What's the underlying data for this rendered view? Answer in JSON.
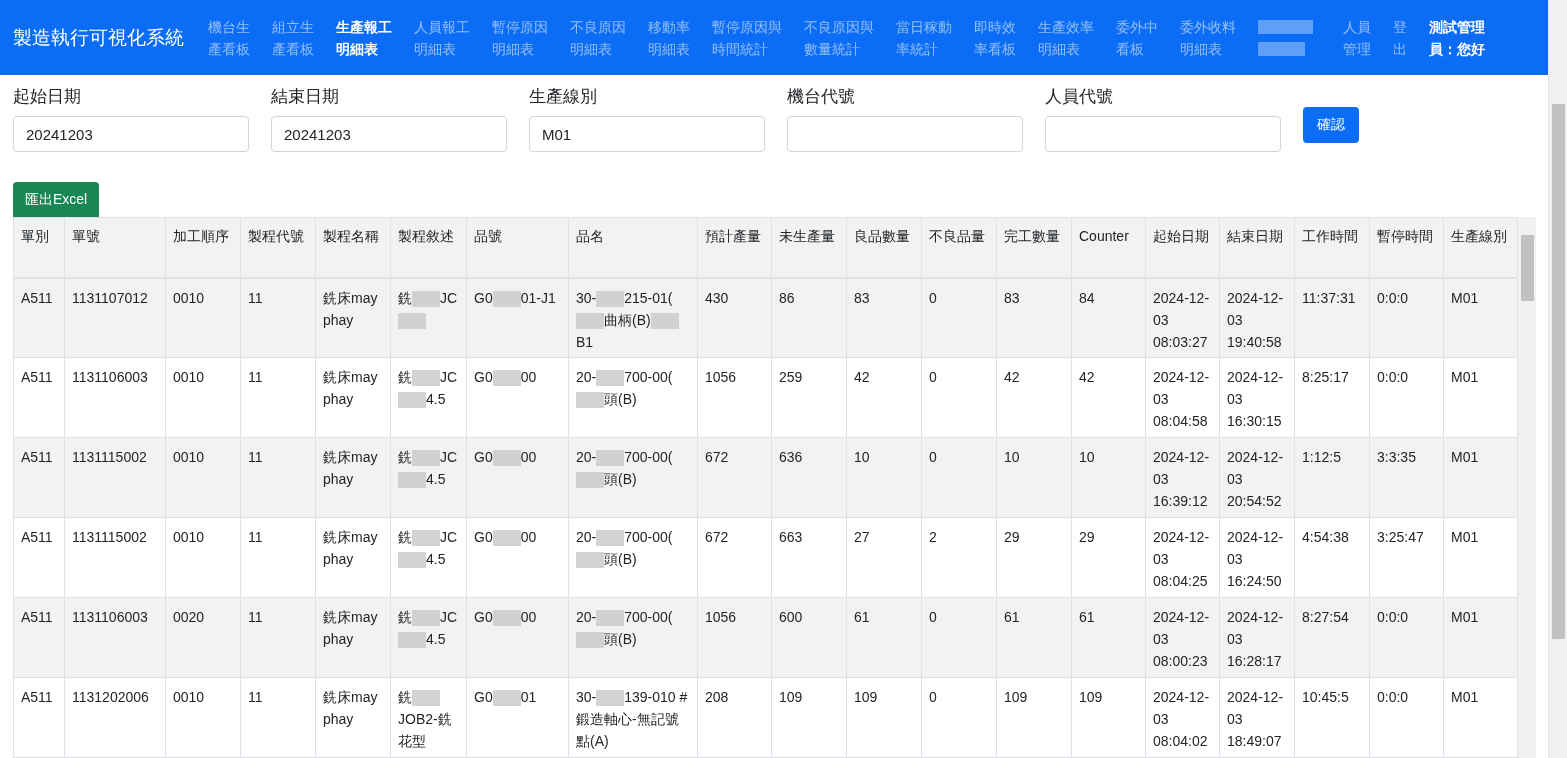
{
  "app_title": "製造執行可視化系統",
  "nav": [
    {
      "kind": "link",
      "lines": [
        "機台生",
        "產看板"
      ],
      "selected": false
    },
    {
      "kind": "link",
      "lines": [
        "組立生",
        "產看板"
      ],
      "selected": false
    },
    {
      "kind": "link",
      "lines": [
        "生產報工",
        "明細表"
      ],
      "selected": true
    },
    {
      "kind": "link",
      "lines": [
        "人員報工",
        "明細表"
      ],
      "selected": false
    },
    {
      "kind": "link",
      "lines": [
        "暫停原因",
        "明細表"
      ],
      "selected": false
    },
    {
      "kind": "link",
      "lines": [
        "不良原因",
        "明細表"
      ],
      "selected": false
    },
    {
      "kind": "link",
      "lines": [
        "移動率",
        "明細表"
      ],
      "selected": false
    },
    {
      "kind": "link",
      "lines": [
        "暫停原因與",
        "時間統計"
      ],
      "selected": false
    },
    {
      "kind": "link",
      "lines": [
        "不良原因與",
        "數量統計"
      ],
      "selected": false
    },
    {
      "kind": "link",
      "lines": [
        "當日稼動",
        "率統計"
      ],
      "selected": false
    },
    {
      "kind": "link",
      "lines": [
        "即時效",
        "率看板"
      ],
      "selected": false
    },
    {
      "kind": "link",
      "lines": [
        "生產效率",
        "明細表"
      ],
      "selected": false
    },
    {
      "kind": "link",
      "lines": [
        "委外中",
        "看板"
      ],
      "selected": false
    },
    {
      "kind": "link",
      "lines": [
        "委外收料",
        "明細表"
      ],
      "selected": false
    },
    {
      "kind": "blurred"
    },
    {
      "kind": "link",
      "lines": [
        "人員",
        "管理"
      ],
      "selected": false
    },
    {
      "kind": "link",
      "lines": [
        "登",
        "出"
      ],
      "selected": false
    },
    {
      "kind": "user",
      "lines": [
        "測試管理",
        "員：您好"
      ]
    }
  ],
  "filters": [
    {
      "label": "起始日期",
      "value": "20241203"
    },
    {
      "label": "結束日期",
      "value": "20241203"
    },
    {
      "label": "生產線別",
      "value": "M01"
    },
    {
      "label": "機台代號"
    },
    {
      "label": "人員代號"
    }
  ],
  "confirm_button": "確認",
  "export_button": "匯出Excel",
  "table": {
    "columns": [
      "單別",
      "單號",
      "加工順序",
      "製程代號",
      "製程名稱",
      "製程敘述",
      "品號",
      "品名",
      "預計產量",
      "未生產量",
      "良品數量",
      "不良品量",
      "完工數量",
      "Counter",
      "起始日期",
      "結束日期",
      "工作時間",
      "暫停時間",
      "生產線別"
    ],
    "rows": [
      [
        "A511",
        "1131107012",
        "0010",
        "11",
        "銑床may phay",
        [
          "銑",
          {
            "kind": "blur"
          },
          "JC",
          {
            "kind": "blur"
          }
        ],
        [
          "G0",
          {
            "kind": "blur"
          },
          "01-J1"
        ],
        [
          "30-",
          {
            "kind": "blur"
          },
          "215-01(",
          {
            "kind": "blur"
          },
          "曲柄(B)",
          {
            "kind": "blur"
          },
          "B1"
        ],
        "430",
        "86",
        "83",
        "0",
        "83",
        "84",
        "2024-12-03 08:03:27",
        "2024-12-03 19:40:58",
        "11:37:31",
        "0:0:0",
        "M01"
      ],
      [
        "A511",
        "1131106003",
        "0010",
        "11",
        "銑床may phay",
        [
          "銑",
          {
            "kind": "blur"
          },
          "JC",
          {
            "kind": "blur"
          },
          "4.5"
        ],
        [
          "G0",
          {
            "kind": "blur"
          },
          "00"
        ],
        [
          "20-",
          {
            "kind": "blur"
          },
          "700-00(",
          {
            "kind": "blur"
          },
          "頭(B)"
        ],
        "1056",
        "259",
        "42",
        "0",
        "42",
        "42",
        "2024-12-03 08:04:58",
        "2024-12-03 16:30:15",
        "8:25:17",
        "0:0:0",
        "M01"
      ],
      [
        "A511",
        "1131115002",
        "0010",
        "11",
        "銑床may phay",
        [
          "銑",
          {
            "kind": "blur"
          },
          "JC",
          {
            "kind": "blur"
          },
          "4.5"
        ],
        [
          "G0",
          {
            "kind": "blur"
          },
          "00"
        ],
        [
          "20-",
          {
            "kind": "blur"
          },
          "700-00(",
          {
            "kind": "blur"
          },
          "頭(B)"
        ],
        "672",
        "636",
        "10",
        "0",
        "10",
        "10",
        "2024-12-03 16:39:12",
        "2024-12-03 20:54:52",
        "1:12:5",
        "3:3:35",
        "M01"
      ],
      [
        "A511",
        "1131115002",
        "0010",
        "11",
        "銑床may phay",
        [
          "銑",
          {
            "kind": "blur"
          },
          "JC",
          {
            "kind": "blur"
          },
          "4.5"
        ],
        [
          "G0",
          {
            "kind": "blur"
          },
          "00"
        ],
        [
          "20-",
          {
            "kind": "blur"
          },
          "700-00(",
          {
            "kind": "blur"
          },
          "頭(B)"
        ],
        "672",
        "663",
        "27",
        "2",
        "29",
        "29",
        "2024-12-03 08:04:25",
        "2024-12-03 16:24:50",
        "4:54:38",
        "3:25:47",
        "M01"
      ],
      [
        "A511",
        "1131106003",
        "0020",
        "11",
        "銑床may phay",
        [
          "銑",
          {
            "kind": "blur"
          },
          "JC",
          {
            "kind": "blur"
          },
          "4.5"
        ],
        [
          "G0",
          {
            "kind": "blur"
          },
          "00"
        ],
        [
          "20-",
          {
            "kind": "blur"
          },
          "700-00(",
          {
            "kind": "blur"
          },
          "頭(B)"
        ],
        "1056",
        "600",
        "61",
        "0",
        "61",
        "61",
        "2024-12-03 08:00:23",
        "2024-12-03 16:28:17",
        "8:27:54",
        "0:0:0",
        "M01"
      ],
      [
        "A511",
        "1131202006",
        "0010",
        "11",
        "銑床may phay",
        [
          "銑",
          {
            "kind": "blur"
          },
          "JOB2-銑花型"
        ],
        [
          "G0",
          {
            "kind": "blur"
          },
          "01"
        ],
        [
          "30-",
          {
            "kind": "blur"
          },
          "139-010 #鍛造軸心-無記號點(A)"
        ],
        "208",
        "109",
        "109",
        "0",
        "109",
        "109",
        "2024-12-03 08:04:02",
        "2024-12-03 18:49:07",
        "10:45:5",
        "0:0:0",
        "M01"
      ]
    ]
  }
}
